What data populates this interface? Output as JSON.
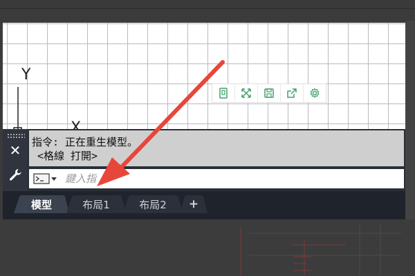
{
  "command_window": {
    "history": [
      "指令: 正在重生模型。",
      "<格線 打開>"
    ],
    "input_placeholder": "鍵入指"
  },
  "layout_tabs": [
    {
      "label": "模型",
      "active": true
    },
    {
      "label": "布局1",
      "active": false
    },
    {
      "label": "布局2",
      "active": false
    },
    {
      "label": "+",
      "active": false
    }
  ],
  "ucs": {
    "x_label": "X",
    "y_label": "Y"
  },
  "viewport_toolbar": {
    "icons": [
      "maximize-viewport-icon",
      "fullscreen-icon",
      "save-icon",
      "share-icon",
      "settings-icon"
    ]
  },
  "colors": {
    "canvas_bg": "#ffffff",
    "grid_line": "#b9bac0",
    "command_bg": "#2a2e36",
    "history_bg": "#cfcfcf",
    "tabbar_bg": "#1f232b",
    "annotation_arrow": "#e8463a",
    "toolbar_icon": "#3fa06a"
  }
}
